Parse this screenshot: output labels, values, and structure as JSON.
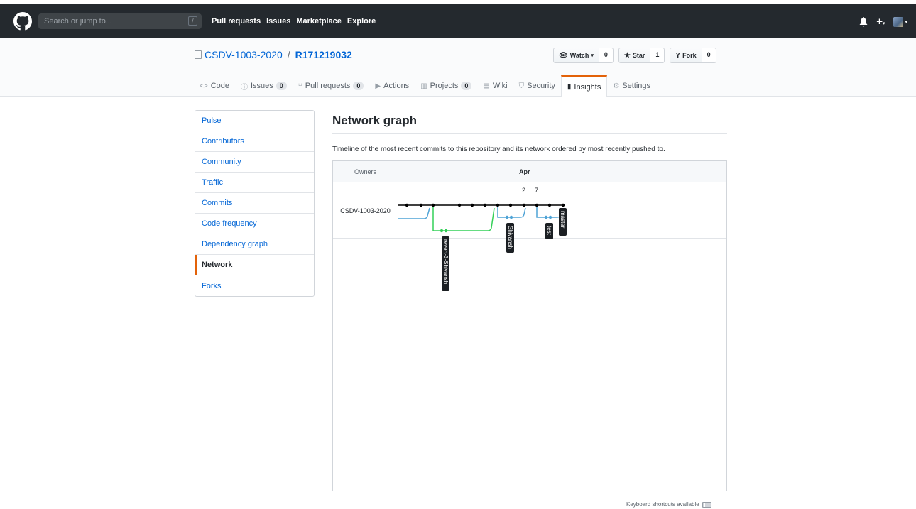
{
  "header": {
    "search_placeholder": "Search or jump to...",
    "search_shortcut": "/",
    "nav": [
      "Pull requests",
      "Issues",
      "Marketplace",
      "Explore"
    ],
    "plus": "+"
  },
  "repo": {
    "owner": "CSDV-1003-2020",
    "separator": "/",
    "name": "R171219032",
    "watch": {
      "label": "Watch",
      "count": "0"
    },
    "star": {
      "label": "Star",
      "count": "1"
    },
    "fork": {
      "label": "Fork",
      "count": "0"
    }
  },
  "tabs": [
    {
      "label": "Code",
      "icon": "code-icon"
    },
    {
      "label": "Issues",
      "icon": "issue-icon",
      "count": "0"
    },
    {
      "label": "Pull requests",
      "icon": "pull-request-icon",
      "count": "0"
    },
    {
      "label": "Actions",
      "icon": "play-icon"
    },
    {
      "label": "Projects",
      "icon": "project-icon",
      "count": "0"
    },
    {
      "label": "Wiki",
      "icon": "book-icon"
    },
    {
      "label": "Security",
      "icon": "shield-icon"
    },
    {
      "label": "Insights",
      "icon": "graph-icon",
      "selected": true
    },
    {
      "label": "Settings",
      "icon": "gear-icon"
    }
  ],
  "sidebar": {
    "items": [
      "Pulse",
      "Contributors",
      "Community",
      "Traffic",
      "Commits",
      "Code frequency",
      "Dependency graph",
      "Network",
      "Forks"
    ],
    "selected": "Network"
  },
  "main": {
    "title": "Network graph",
    "description": "Timeline of the most recent commits to this repository and its network ordered by most recently pushed to.",
    "owners_header": "Owners",
    "month": "Apr",
    "days": [
      "2",
      "7"
    ],
    "owner": "CSDV-1003-2020",
    "branches": [
      "revert-3-Shivansh",
      "Shivansh",
      "test",
      "master"
    ]
  },
  "footer": {
    "shortcuts": "Keyboard shortcuts available"
  },
  "colors": {
    "header": "#24292e",
    "link": "#0366d6",
    "accent": "#e36209",
    "branch_blue": "#4fa3d6",
    "branch_green": "#34d058"
  }
}
